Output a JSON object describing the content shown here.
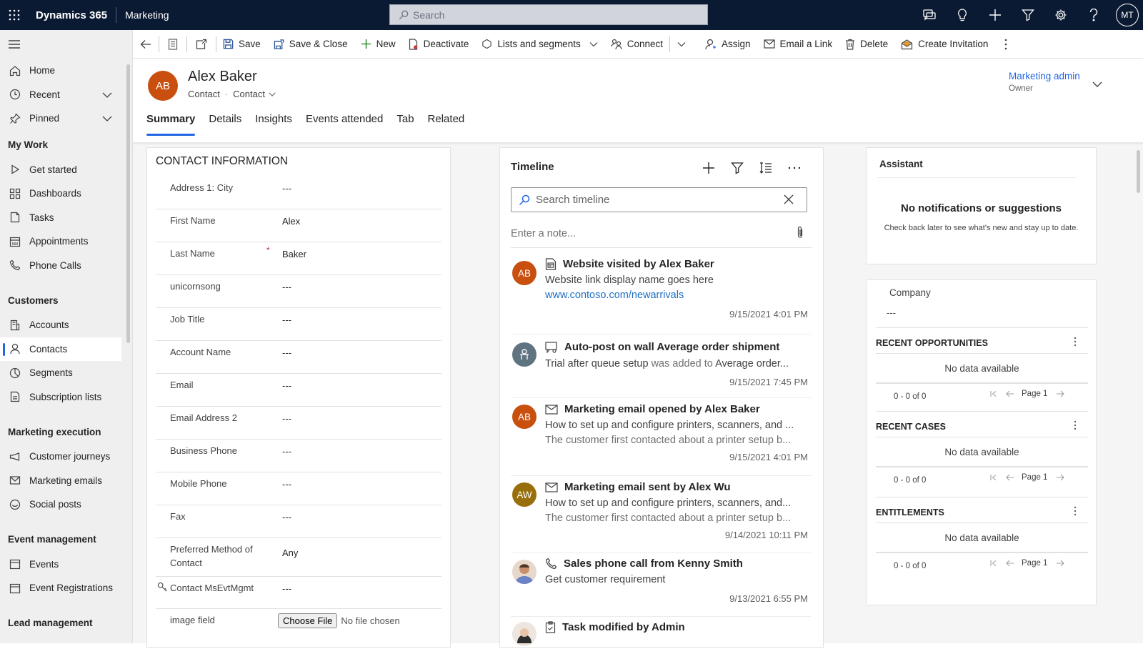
{
  "topbar": {
    "brand": "Dynamics 365",
    "app": "Marketing",
    "search_placeholder": "Search",
    "user_initials": "MT",
    "icons": [
      "chat-icon",
      "lightbulb-icon",
      "plus-icon",
      "filter-icon",
      "gear-icon",
      "help-icon"
    ]
  },
  "sidebar": {
    "top_items": [
      {
        "label": "Home",
        "icon": "home-icon"
      },
      {
        "label": "Recent",
        "icon": "clock-icon",
        "expandable": true
      },
      {
        "label": "Pinned",
        "icon": "pin-icon",
        "expandable": true
      }
    ],
    "groups": [
      {
        "title": "My Work",
        "items": [
          {
            "label": "Get started",
            "icon": "play-icon"
          },
          {
            "label": "Dashboards",
            "icon": "dashboard-icon"
          },
          {
            "label": "Tasks",
            "icon": "task-icon"
          },
          {
            "label": "Appointments",
            "icon": "calendar-icon"
          },
          {
            "label": "Phone Calls",
            "icon": "phone-icon"
          }
        ]
      },
      {
        "title": "Customers",
        "items": [
          {
            "label": "Accounts",
            "icon": "account-icon"
          },
          {
            "label": "Contacts",
            "icon": "person-icon",
            "active": true
          },
          {
            "label": "Segments",
            "icon": "segment-icon"
          },
          {
            "label": "Subscription lists",
            "icon": "list-icon"
          }
        ]
      },
      {
        "title": "Marketing execution",
        "items": [
          {
            "label": "Customer journeys",
            "icon": "megaphone-icon"
          },
          {
            "label": "Marketing emails",
            "icon": "mail-icon"
          },
          {
            "label": "Social posts",
            "icon": "social-icon"
          }
        ]
      },
      {
        "title": "Event management",
        "items": [
          {
            "label": "Events",
            "icon": "calendar-icon"
          },
          {
            "label": "Event Registrations",
            "icon": "calendar-icon"
          }
        ]
      },
      {
        "title": "Lead management",
        "items": []
      }
    ]
  },
  "commandbar": {
    "save": "Save",
    "save_close": "Save & Close",
    "new": "New",
    "deactivate": "Deactivate",
    "lists_segments": "Lists and segments",
    "connect": "Connect",
    "assign": "Assign",
    "email_link": "Email a Link",
    "delete": "Delete",
    "create_invitation": "Create Invitation"
  },
  "record": {
    "initials": "AB",
    "name": "Alex Baker",
    "entity": "Contact",
    "form": "Contact",
    "owner_name": "Marketing admin",
    "owner_label": "Owner",
    "avatar_color": "#c94f0f",
    "tabs": [
      {
        "label": "Summary",
        "active": true
      },
      {
        "label": "Details"
      },
      {
        "label": "Insights"
      },
      {
        "label": "Events attended"
      },
      {
        "label": "Tab"
      },
      {
        "label": "Related"
      }
    ]
  },
  "contact_info": {
    "title": "CONTACT INFORMATION",
    "fields": [
      {
        "label": "Address 1: City",
        "value": "---"
      },
      {
        "label": "First Name",
        "value": "Alex"
      },
      {
        "label": "Last Name",
        "value": "Baker",
        "required": true
      },
      {
        "label": "unicornsong",
        "value": "---"
      },
      {
        "label": "Job Title",
        "value": "---"
      },
      {
        "label": "Account Name",
        "value": "---"
      },
      {
        "label": "Email",
        "value": "---"
      },
      {
        "label": "Email Address 2",
        "value": "---"
      },
      {
        "label": "Business Phone",
        "value": "---"
      },
      {
        "label": "Mobile Phone",
        "value": "---"
      },
      {
        "label": "Fax",
        "value": "---"
      },
      {
        "label": "Preferred Method of Contact",
        "value": "Any"
      },
      {
        "label": "Contact MsEvtMgmt",
        "value": "---",
        "locked": true
      },
      {
        "label": "image field",
        "file_button": "Choose File",
        "file_status": "No file chosen"
      }
    ]
  },
  "timeline": {
    "title": "Timeline",
    "search_placeholder": "Search timeline",
    "note_placeholder": "Enter a note...",
    "items": [
      {
        "avatar": "AB",
        "avatar_color": "#c94f0f",
        "icon": "web-page-icon",
        "title": "Website visited by Alex Baker",
        "line1": "Website link display name goes here",
        "link": "www.contoso.com/newarrivals",
        "timestamp": "9/15/2021   4:01 PM"
      },
      {
        "avatar": "",
        "avatar_color": "#5f7381",
        "icon": "post-icon",
        "title": "Auto-post on wall Average order shipment",
        "line1_a": "Trial after queue setup",
        "line1_b": " was added to ",
        "line1_c": "Average order...",
        "timestamp": "9/15/2021   7:45 PM"
      },
      {
        "avatar": "AB",
        "avatar_color": "#c94f0f",
        "icon": "mail-icon",
        "title": "Marketing email opened by Alex Baker",
        "line1": "How to set up and configure printers, scanners, and ...",
        "line2": "The customer first contacted about a printer setup b...",
        "timestamp": "9/15/2021   4:01 PM"
      },
      {
        "avatar": "AW",
        "avatar_color": "#986f0b",
        "icon": "mail-icon",
        "title": "Marketing email sent by Alex Wu",
        "line1": "How to set up and configure printers, scanners, and...",
        "line2": "The customer first contacted about a printer setup b...",
        "timestamp": "9/14/2021   10:11 PM"
      },
      {
        "avatar": "",
        "avatar_color": "#d9c7b4",
        "icon": "phone-icon",
        "title": "Sales phone call from Kenny Smith",
        "line1": "Get customer requirement",
        "timestamp": "9/13/2021   6:55 PM"
      },
      {
        "avatar": "",
        "avatar_color": "#e7ddd4",
        "icon": "task-icon",
        "title": "Task modified by Admin"
      }
    ]
  },
  "assistant": {
    "title": "Assistant",
    "heading": "No notifications or suggestions",
    "sub": "Check back later to see what's new and stay up to date."
  },
  "related": {
    "company_label": "Company",
    "company_value": "---",
    "subgrids": [
      {
        "title": "RECENT OPPORTUNITIES",
        "empty": "No data available",
        "count": "0 - 0 of 0",
        "page": "Page 1"
      },
      {
        "title": "RECENT CASES",
        "empty": "No data available",
        "count": "0 - 0 of 0",
        "page": "Page 1"
      },
      {
        "title": "ENTITLEMENTS",
        "empty": "No data available",
        "count": "0 - 0 of 0",
        "page": "Page 1"
      }
    ]
  }
}
